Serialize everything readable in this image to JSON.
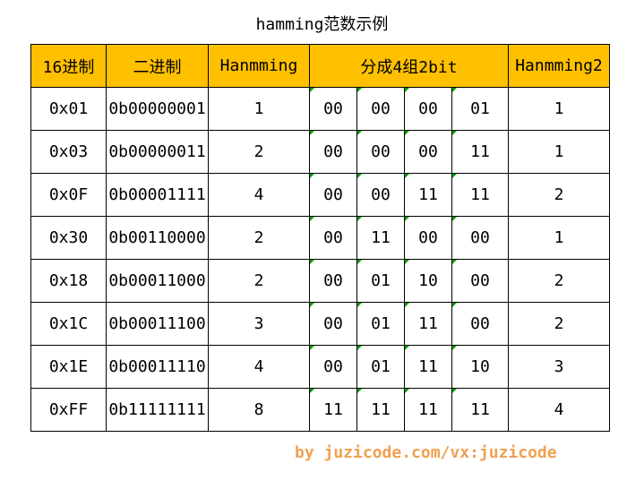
{
  "title": "hamming范数示例",
  "headers": {
    "hex": "16进制",
    "bin": "二进制",
    "hamming": "Hanmming",
    "groups": "分成4组2bit",
    "hamming2": "Hanmming2"
  },
  "rows": [
    {
      "hex": "0x01",
      "bin": "0b00000001",
      "hamming": "1",
      "g": [
        "00",
        "00",
        "00",
        "01"
      ],
      "hamming2": "1"
    },
    {
      "hex": "0x03",
      "bin": "0b00000011",
      "hamming": "2",
      "g": [
        "00",
        "00",
        "00",
        "11"
      ],
      "hamming2": "1"
    },
    {
      "hex": "0x0F",
      "bin": "0b00001111",
      "hamming": "4",
      "g": [
        "00",
        "00",
        "11",
        "11"
      ],
      "hamming2": "2"
    },
    {
      "hex": "0x30",
      "bin": "0b00110000",
      "hamming": "2",
      "g": [
        "00",
        "11",
        "00",
        "00"
      ],
      "hamming2": "1"
    },
    {
      "hex": "0x18",
      "bin": "0b00011000",
      "hamming": "2",
      "g": [
        "00",
        "01",
        "10",
        "00"
      ],
      "hamming2": "2"
    },
    {
      "hex": "0x1C",
      "bin": "0b00011100",
      "hamming": "3",
      "g": [
        "00",
        "01",
        "11",
        "00"
      ],
      "hamming2": "2"
    },
    {
      "hex": "0x1E",
      "bin": "0b00011110",
      "hamming": "4",
      "g": [
        "00",
        "01",
        "11",
        "10"
      ],
      "hamming2": "3"
    },
    {
      "hex": "0xFF",
      "bin": "0b11111111",
      "hamming": "8",
      "g": [
        "11",
        "11",
        "11",
        "11"
      ],
      "hamming2": "4"
    }
  ],
  "footer": "by juzicode.com/vx:juzicode",
  "colors": {
    "header_bg": "#ffc000",
    "footer_text": "#f0a050",
    "cell_marker": "#00a000"
  }
}
